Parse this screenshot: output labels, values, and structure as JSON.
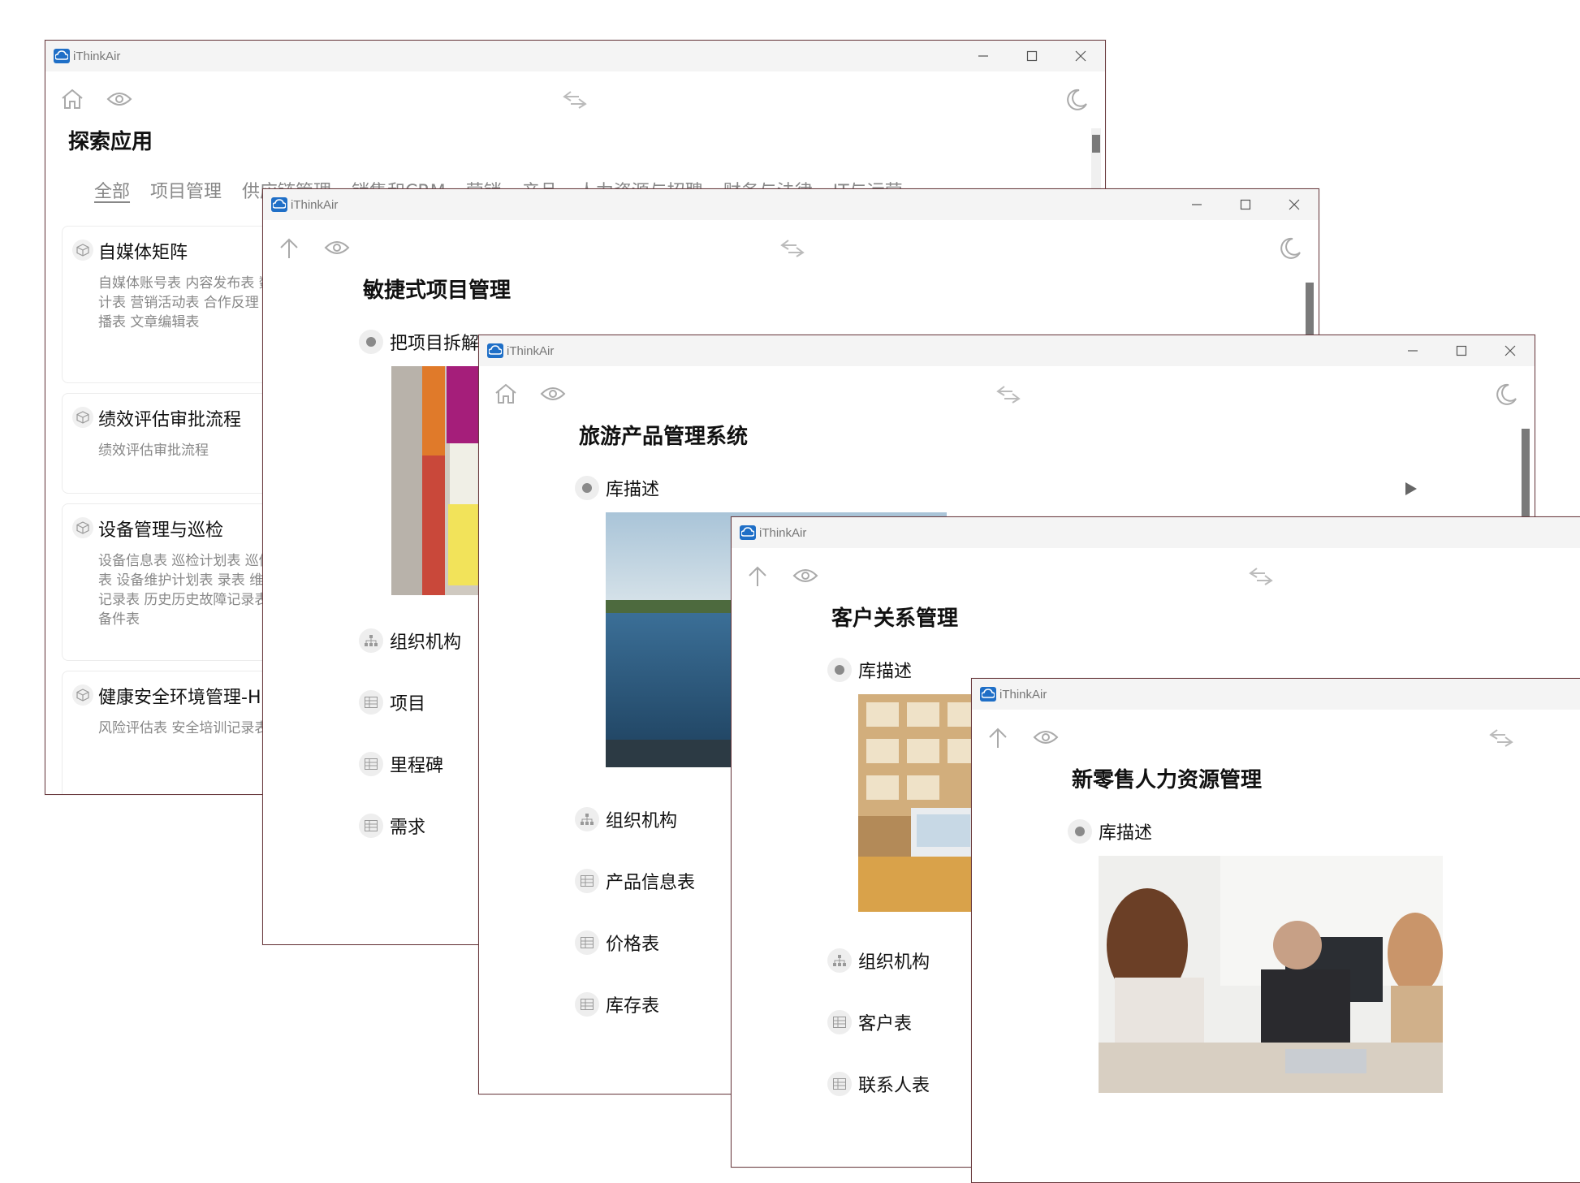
{
  "app": {
    "name": "iThinkAir"
  },
  "window1": {
    "title": "探索应用",
    "tabs": [
      "全部",
      "项目管理",
      "供应链管理",
      "销售和CRM",
      "营销",
      "产品",
      "人力资源与招聘",
      "财务与法律",
      "IT与运营"
    ],
    "cards": [
      {
        "title": "自媒体矩阵",
        "desc": "自媒体账号表 内容发布表 数据统计表 营销活动表 合作反理 视频直播表 文章编辑表"
      },
      {
        "title": "绩效评估审批流程",
        "desc": "绩效评估审批流程"
      },
      {
        "title": "设备管理与巡检",
        "desc": "设备信息表 巡检计划表 巡修记录表 设备维护计划表 录表 维修费用记录表 历史历史故障记录表 设备备件表"
      },
      {
        "title": "健康安全环境管理-HSE",
        "desc": "风险评估表 安全培训记录表"
      }
    ]
  },
  "window2": {
    "title": "敏捷式项目管理",
    "items": [
      "把项目拆解",
      "组织机构",
      "项目",
      "里程碑",
      "需求"
    ]
  },
  "window3": {
    "title": "旅游产品管理系统",
    "items": [
      "库描述",
      "组织机构",
      "产品信息表",
      "价格表",
      "库存表"
    ]
  },
  "window4": {
    "title": "客户关系管理",
    "items": [
      "库描述",
      "组织机构",
      "客户表",
      "联系人表"
    ]
  },
  "window5": {
    "title": "新零售人力资源管理",
    "items": [
      "库描述"
    ]
  },
  "colors": {
    "accent": "#1f6fc7",
    "border": "#6a3a3e",
    "titlebar": "#f4f4f4"
  },
  "icons": [
    "home-icon",
    "eye-icon",
    "swap-icon",
    "moon-icon",
    "back-arrow-icon",
    "minimize-icon",
    "maximize-icon",
    "close-icon",
    "cube-icon",
    "org-chart-icon",
    "table-icon",
    "play-icon"
  ]
}
